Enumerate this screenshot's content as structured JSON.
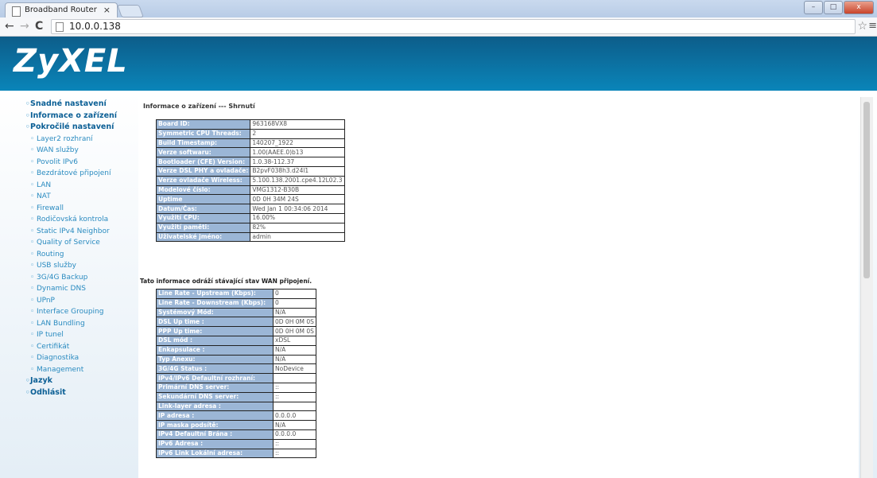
{
  "browser": {
    "tab_title": "Broadband Router",
    "tab_close": "×",
    "url": "10.0.0.138",
    "back": "←",
    "forward": "→",
    "reload": "C",
    "minimize": "–",
    "maximize": "□",
    "close": "x"
  },
  "header": {
    "logo": "ZyXEL"
  },
  "sidebar": {
    "items": [
      {
        "label": "Snadné nastavení",
        "level": "top"
      },
      {
        "label": "Informace o zařízení",
        "level": "top"
      },
      {
        "label": "Pokročilé nastavení",
        "level": "top"
      },
      {
        "label": "Layer2 rozhraní",
        "level": "sub"
      },
      {
        "label": "WAN služby",
        "level": "sub"
      },
      {
        "label": "Povolit IPv6",
        "level": "sub"
      },
      {
        "label": "Bezdrátové připojení",
        "level": "sub"
      },
      {
        "label": "LAN",
        "level": "sub"
      },
      {
        "label": "NAT",
        "level": "sub"
      },
      {
        "label": "Firewall",
        "level": "sub"
      },
      {
        "label": "Rodičovská kontrola",
        "level": "sub"
      },
      {
        "label": "Static IPv4 Neighbor",
        "level": "sub"
      },
      {
        "label": "Quality of Service",
        "level": "sub"
      },
      {
        "label": "Routing",
        "level": "sub"
      },
      {
        "label": "USB služby",
        "level": "sub"
      },
      {
        "label": "3G/4G Backup",
        "level": "sub"
      },
      {
        "label": "Dynamic DNS",
        "level": "sub"
      },
      {
        "label": "UPnP",
        "level": "sub"
      },
      {
        "label": "Interface Grouping",
        "level": "sub"
      },
      {
        "label": "LAN Bundling",
        "level": "sub"
      },
      {
        "label": "IP tunel",
        "level": "sub"
      },
      {
        "label": "Certifikát",
        "level": "sub"
      },
      {
        "label": "Diagnostika",
        "level": "sub"
      },
      {
        "label": "Management",
        "level": "sub"
      },
      {
        "label": "Jazyk",
        "level": "top"
      },
      {
        "label": "Odhlásit",
        "level": "top"
      }
    ]
  },
  "main": {
    "heading": "Informace o zařízení --- Shrnutí",
    "device_info": [
      {
        "label": "Board ID:",
        "value": "963168VX8"
      },
      {
        "label": "Symmetric CPU Threads:",
        "value": "2"
      },
      {
        "label": "Build Timestamp:",
        "value": "140207_1922"
      },
      {
        "label": "Verze softwaru:",
        "value": "1.00(AAEE.0)b13"
      },
      {
        "label": "Bootloader (CFE) Version:",
        "value": "1.0.38-112.37"
      },
      {
        "label": "Verze DSL PHY a ovladače:",
        "value": "B2pvF038h3.d24l1"
      },
      {
        "label": "Verze ovladače Wireless:",
        "value": "5.100.138.2001.cpe4.12L02.3"
      },
      {
        "label": "Modelové číslo:",
        "value": "VMG1312-B30B"
      },
      {
        "label": "Uptime",
        "value": "0D 0H 34M 24S"
      },
      {
        "label": "Datum/Čas:",
        "value": "Wed Jan 1 00:34:06 2014"
      },
      {
        "label": "Využití CPU:",
        "value": "16.00%"
      },
      {
        "label": "Využití paměti:",
        "value": "82%"
      },
      {
        "label": "Uživatelské jméno:",
        "value": "admin"
      }
    ],
    "wan_note": "Tato informace odráží stávající stav WAN připojení.",
    "wan_info": [
      {
        "label": "Line Rate - Upstream (Kbps):",
        "value": "0"
      },
      {
        "label": "Line Rate - Downstream (Kbps):",
        "value": "0"
      },
      {
        "label": "Systémový Mód:",
        "value": "N/A"
      },
      {
        "label": "DSL Up time :",
        "value": "0D 0H 0M 0S"
      },
      {
        "label": "PPP Up time:",
        "value": "0D 0H 0M 0S"
      },
      {
        "label": "DSL mód :",
        "value": "xDSL"
      },
      {
        "label": "Enkapsulace :",
        "value": "N/A"
      },
      {
        "label": "Typ Anexu:",
        "value": "N/A"
      },
      {
        "label": "3G/4G Status :",
        "value": "NoDevice"
      },
      {
        "label": "IPv4/IPv6 Defaultní rozhraní:",
        "value": ""
      },
      {
        "label": "Primární DNS server:",
        "value": "::"
      },
      {
        "label": "Sekundární DNS server:",
        "value": "::"
      },
      {
        "label": "Link-layer adresa :",
        "value": ""
      },
      {
        "label": "IP adresa :",
        "value": "0.0.0.0"
      },
      {
        "label": "IP maska podsítě:",
        "value": "N/A"
      },
      {
        "label": "IPv4 Defaultní Brána :",
        "value": "0.0.0.0"
      },
      {
        "label": "IPv6 Adresa :",
        "value": "::"
      },
      {
        "label": "IPv6 Link Lokální adresa:",
        "value": "::"
      }
    ]
  }
}
